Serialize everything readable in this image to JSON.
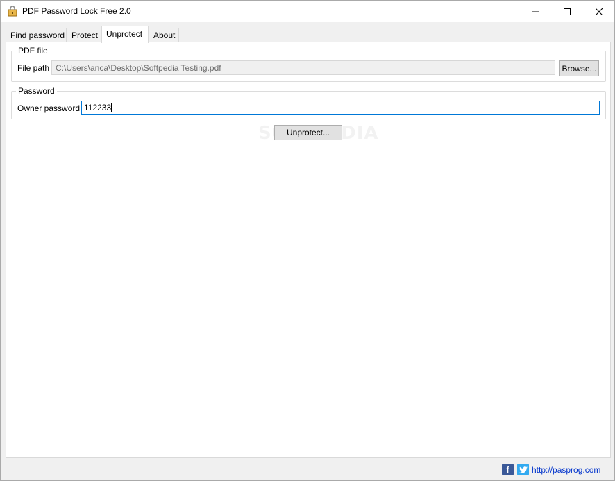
{
  "window": {
    "title": "PDF Password Lock Free 2.0",
    "icon": "app-icon",
    "controls": [
      "minimize-icon",
      "maximize-icon",
      "close-icon"
    ]
  },
  "tabs": [
    {
      "label": "Find password"
    },
    {
      "label": "Protect"
    },
    {
      "label": "Unprotect",
      "active": true
    },
    {
      "label": "About"
    }
  ],
  "pdf_group": {
    "legend": "PDF file",
    "file_path_label": "File path",
    "file_path_value": "C:\\Users\\anca\\Desktop\\Softpedia Testing.pdf",
    "browse_label": "Browse..."
  },
  "password_group": {
    "legend": "Password",
    "owner_label": "Owner password",
    "owner_value": "112233"
  },
  "unprotect_button": "Unprotect...",
  "watermark": "SOFTPEDIA",
  "footer": {
    "facebook_icon": "facebook-icon",
    "twitter_icon": "twitter-icon",
    "link": "http://pasprog.com"
  },
  "colors": {
    "focus_border": "#0078d7",
    "link": "#0033cc",
    "facebook": "#3b5998",
    "twitter": "#33aaf0"
  }
}
